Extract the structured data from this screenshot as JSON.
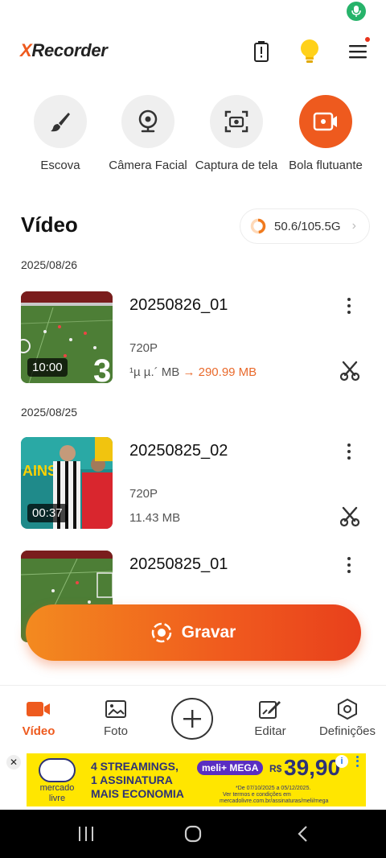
{
  "app": {
    "logo_x": "X",
    "logo_rest": "Recorder"
  },
  "header": {
    "icons": [
      "battery-alert-icon",
      "lightbulb-icon",
      "menu-icon"
    ]
  },
  "tools": [
    {
      "label": "Escova",
      "icon": "brush-icon"
    },
    {
      "label": "Câmera Facial",
      "icon": "webcam-icon"
    },
    {
      "label": "Captura de tela",
      "icon": "screenshot-icon"
    },
    {
      "label": "Bola flutuante",
      "icon": "floating-ball-icon"
    }
  ],
  "video": {
    "title": "Vídeo",
    "storage": "50.6/105.5G",
    "storage_used_fraction": 0.48
  },
  "groups": [
    {
      "date": "2025/08/26",
      "items": [
        {
          "name": "20250826_01",
          "duration": "10:00",
          "resolution": "720P",
          "size_old": "¹µ µ.´ MB",
          "size_arrow": "→",
          "size_new": "290.99 MB"
        }
      ]
    },
    {
      "date": "2025/08/25",
      "items": [
        {
          "name": "20250825_02",
          "duration": "00:37",
          "resolution": "720P",
          "size": "11.43 MB"
        },
        {
          "name": "20250825_01"
        }
      ]
    }
  ],
  "record_button": "Gravar",
  "nav": [
    {
      "label": "Vídeo",
      "active": true
    },
    {
      "label": "Foto"
    },
    {
      "label": ""
    },
    {
      "label": "Editar"
    },
    {
      "label": "Definições"
    }
  ],
  "ad": {
    "brand_line1": "mercado",
    "brand_line2": "livre",
    "line1": "4 STREAMINGS,",
    "line2": "1 ASSINATURA",
    "line3": "MAIS ECONOMIA",
    "badge": "meli+ MEGA",
    "price_currency": "R$",
    "price": "39,90",
    "fine1": "*De 07/10/2025 a 05/12/2025.",
    "fine2": "Ver termos e condições em",
    "fine3": "mercadolivre.com.br/assinaturas/meli/mega",
    "close": "✕",
    "info": "i"
  },
  "colors": {
    "accent": "#ee5a1e",
    "ad_yellow": "#ffe600",
    "ad_navy": "#2d3277"
  }
}
